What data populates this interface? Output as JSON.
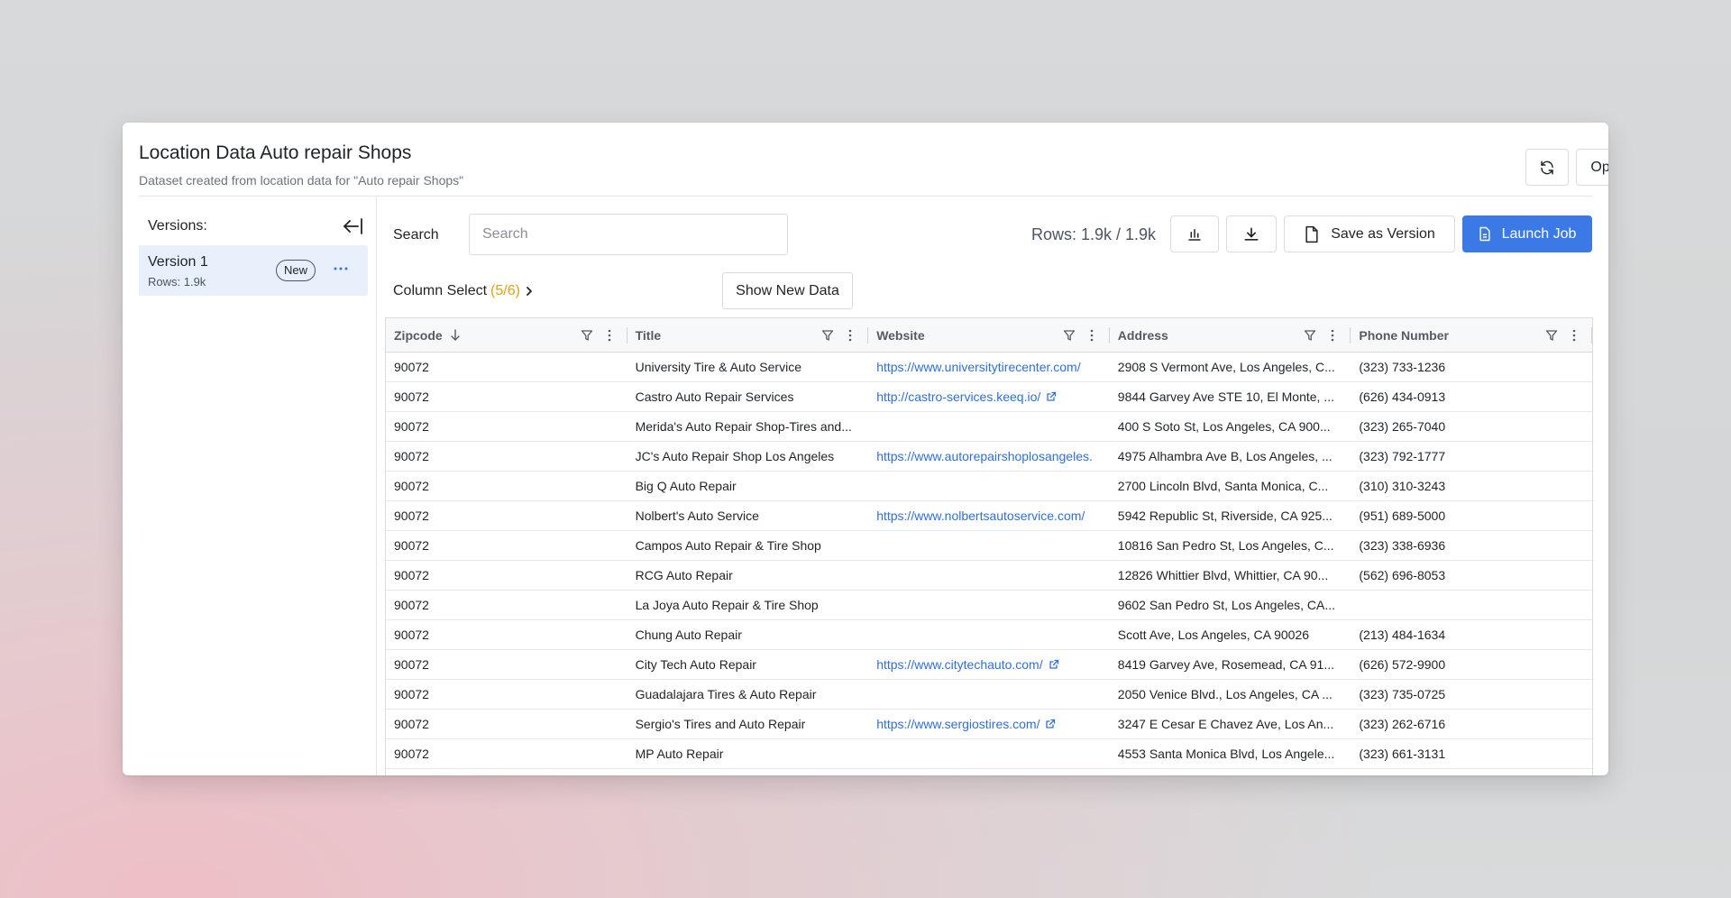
{
  "header": {
    "title": "Location Data Auto repair Shops",
    "subtitle": "Dataset created from location data for \"Auto repair Shops\"",
    "options_label": "Options"
  },
  "sidebar": {
    "versions_label": "Versions:",
    "versions": [
      {
        "name": "Version 1",
        "rows": "Rows: 1.9k",
        "badge": "New"
      }
    ]
  },
  "toolbar": {
    "search_label": "Search",
    "search_placeholder": "Search",
    "rows_count": "Rows: 1.9k / 1.9k",
    "save_label": "Save as Version",
    "launch_label": "Launch Job",
    "column_select_label": "Column Select",
    "column_select_count": "(5/6)",
    "show_new_label": "Show New Data"
  },
  "table": {
    "columns": [
      "Zipcode",
      "Title",
      "Website",
      "Address",
      "Phone Number"
    ],
    "rows": [
      [
        "90072",
        "University Tire & Auto Service",
        "https://www.universitytirecenter.com/",
        "2908 S Vermont Ave, Los Angeles, C...",
        "(323) 733-1236"
      ],
      [
        "90072",
        "Castro Auto Repair Services",
        "http://castro-services.keeq.io/",
        "9844 Garvey Ave STE 10, El Monte, ...",
        "(626) 434-0913"
      ],
      [
        "90072",
        "Merida's Auto Repair Shop-Tires and...",
        "",
        "400 S Soto St, Los Angeles, CA 900...",
        "(323) 265-7040"
      ],
      [
        "90072",
        "JC's Auto Repair Shop Los Angeles",
        "https://www.autorepairshoplosangeles.",
        "4975 Alhambra Ave B, Los Angeles, ...",
        "(323) 792-1777"
      ],
      [
        "90072",
        "Big Q Auto Repair",
        "",
        "2700 Lincoln Blvd, Santa Monica, C...",
        "(310) 310-3243"
      ],
      [
        "90072",
        "Nolbert's Auto Service",
        "https://www.nolbertsautoservice.com/",
        "5942 Republic St, Riverside, CA 925...",
        "(951) 689-5000"
      ],
      [
        "90072",
        "Campos Auto Repair & Tire Shop",
        "",
        "10816 San Pedro St, Los Angeles, C...",
        "(323) 338-6936"
      ],
      [
        "90072",
        "RCG Auto Repair",
        "",
        "12826 Whittier Blvd, Whittier, CA 90...",
        "(562) 696-8053"
      ],
      [
        "90072",
        "La Joya Auto Repair & Tire Shop",
        "",
        "9602 San Pedro St, Los Angeles, CA...",
        ""
      ],
      [
        "90072",
        "Chung Auto Repair",
        "",
        "Scott Ave, Los Angeles, CA 90026",
        "(213) 484-1634"
      ],
      [
        "90072",
        "City Tech Auto Repair",
        "https://www.citytechauto.com/",
        "8419 Garvey Ave, Rosemead, CA 91...",
        "(626) 572-9900"
      ],
      [
        "90072",
        "Guadalajara Tires & Auto Repair",
        "",
        "2050 Venice Blvd., Los Angeles, CA ...",
        "(323) 735-0725"
      ],
      [
        "90072",
        "Sergio's Tires and Auto Repair",
        "https://www.sergiostires.com/",
        "3247 E Cesar E Chavez Ave, Los An...",
        "(323) 262-6716"
      ],
      [
        "90072",
        "MP Auto Repair",
        "",
        "4553 Santa Monica Blvd, Los Angele...",
        "(323) 661-3131"
      ]
    ]
  },
  "icons": {
    "refresh": "refresh-icon",
    "more": "more-horizontal-icon",
    "collapse": "collapse-left-icon",
    "chart": "bar-chart-icon",
    "download": "download-icon",
    "file": "file-icon",
    "filter": "filter-icon",
    "sort": "sort-down-icon",
    "external": "external-link-icon"
  },
  "colors": {
    "accent": "#3b7ae6",
    "link": "#2f6fd6",
    "count": "#e0a213",
    "selected_bg": "#e8f0fc"
  }
}
